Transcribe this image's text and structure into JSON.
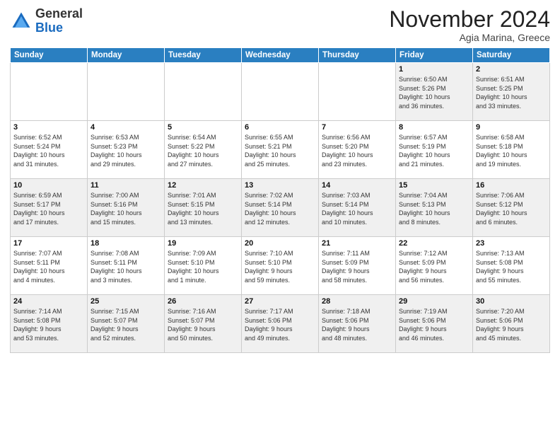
{
  "header": {
    "logo_general": "General",
    "logo_blue": "Blue",
    "month_title": "November 2024",
    "location": "Agia Marina, Greece"
  },
  "weekdays": [
    "Sunday",
    "Monday",
    "Tuesday",
    "Wednesday",
    "Thursday",
    "Friday",
    "Saturday"
  ],
  "weeks": [
    {
      "days": [
        {
          "num": "",
          "info": ""
        },
        {
          "num": "",
          "info": ""
        },
        {
          "num": "",
          "info": ""
        },
        {
          "num": "",
          "info": ""
        },
        {
          "num": "",
          "info": ""
        },
        {
          "num": "1",
          "info": "Sunrise: 6:50 AM\nSunset: 5:26 PM\nDaylight: 10 hours\nand 36 minutes."
        },
        {
          "num": "2",
          "info": "Sunrise: 6:51 AM\nSunset: 5:25 PM\nDaylight: 10 hours\nand 33 minutes."
        }
      ]
    },
    {
      "days": [
        {
          "num": "3",
          "info": "Sunrise: 6:52 AM\nSunset: 5:24 PM\nDaylight: 10 hours\nand 31 minutes."
        },
        {
          "num": "4",
          "info": "Sunrise: 6:53 AM\nSunset: 5:23 PM\nDaylight: 10 hours\nand 29 minutes."
        },
        {
          "num": "5",
          "info": "Sunrise: 6:54 AM\nSunset: 5:22 PM\nDaylight: 10 hours\nand 27 minutes."
        },
        {
          "num": "6",
          "info": "Sunrise: 6:55 AM\nSunset: 5:21 PM\nDaylight: 10 hours\nand 25 minutes."
        },
        {
          "num": "7",
          "info": "Sunrise: 6:56 AM\nSunset: 5:20 PM\nDaylight: 10 hours\nand 23 minutes."
        },
        {
          "num": "8",
          "info": "Sunrise: 6:57 AM\nSunset: 5:19 PM\nDaylight: 10 hours\nand 21 minutes."
        },
        {
          "num": "9",
          "info": "Sunrise: 6:58 AM\nSunset: 5:18 PM\nDaylight: 10 hours\nand 19 minutes."
        }
      ]
    },
    {
      "days": [
        {
          "num": "10",
          "info": "Sunrise: 6:59 AM\nSunset: 5:17 PM\nDaylight: 10 hours\nand 17 minutes."
        },
        {
          "num": "11",
          "info": "Sunrise: 7:00 AM\nSunset: 5:16 PM\nDaylight: 10 hours\nand 15 minutes."
        },
        {
          "num": "12",
          "info": "Sunrise: 7:01 AM\nSunset: 5:15 PM\nDaylight: 10 hours\nand 13 minutes."
        },
        {
          "num": "13",
          "info": "Sunrise: 7:02 AM\nSunset: 5:14 PM\nDaylight: 10 hours\nand 12 minutes."
        },
        {
          "num": "14",
          "info": "Sunrise: 7:03 AM\nSunset: 5:14 PM\nDaylight: 10 hours\nand 10 minutes."
        },
        {
          "num": "15",
          "info": "Sunrise: 7:04 AM\nSunset: 5:13 PM\nDaylight: 10 hours\nand 8 minutes."
        },
        {
          "num": "16",
          "info": "Sunrise: 7:06 AM\nSunset: 5:12 PM\nDaylight: 10 hours\nand 6 minutes."
        }
      ]
    },
    {
      "days": [
        {
          "num": "17",
          "info": "Sunrise: 7:07 AM\nSunset: 5:11 PM\nDaylight: 10 hours\nand 4 minutes."
        },
        {
          "num": "18",
          "info": "Sunrise: 7:08 AM\nSunset: 5:11 PM\nDaylight: 10 hours\nand 3 minutes."
        },
        {
          "num": "19",
          "info": "Sunrise: 7:09 AM\nSunset: 5:10 PM\nDaylight: 10 hours\nand 1 minute."
        },
        {
          "num": "20",
          "info": "Sunrise: 7:10 AM\nSunset: 5:10 PM\nDaylight: 9 hours\nand 59 minutes."
        },
        {
          "num": "21",
          "info": "Sunrise: 7:11 AM\nSunset: 5:09 PM\nDaylight: 9 hours\nand 58 minutes."
        },
        {
          "num": "22",
          "info": "Sunrise: 7:12 AM\nSunset: 5:09 PM\nDaylight: 9 hours\nand 56 minutes."
        },
        {
          "num": "23",
          "info": "Sunrise: 7:13 AM\nSunset: 5:08 PM\nDaylight: 9 hours\nand 55 minutes."
        }
      ]
    },
    {
      "days": [
        {
          "num": "24",
          "info": "Sunrise: 7:14 AM\nSunset: 5:08 PM\nDaylight: 9 hours\nand 53 minutes."
        },
        {
          "num": "25",
          "info": "Sunrise: 7:15 AM\nSunset: 5:07 PM\nDaylight: 9 hours\nand 52 minutes."
        },
        {
          "num": "26",
          "info": "Sunrise: 7:16 AM\nSunset: 5:07 PM\nDaylight: 9 hours\nand 50 minutes."
        },
        {
          "num": "27",
          "info": "Sunrise: 7:17 AM\nSunset: 5:06 PM\nDaylight: 9 hours\nand 49 minutes."
        },
        {
          "num": "28",
          "info": "Sunrise: 7:18 AM\nSunset: 5:06 PM\nDaylight: 9 hours\nand 48 minutes."
        },
        {
          "num": "29",
          "info": "Sunrise: 7:19 AM\nSunset: 5:06 PM\nDaylight: 9 hours\nand 46 minutes."
        },
        {
          "num": "30",
          "info": "Sunrise: 7:20 AM\nSunset: 5:06 PM\nDaylight: 9 hours\nand 45 minutes."
        }
      ]
    }
  ]
}
